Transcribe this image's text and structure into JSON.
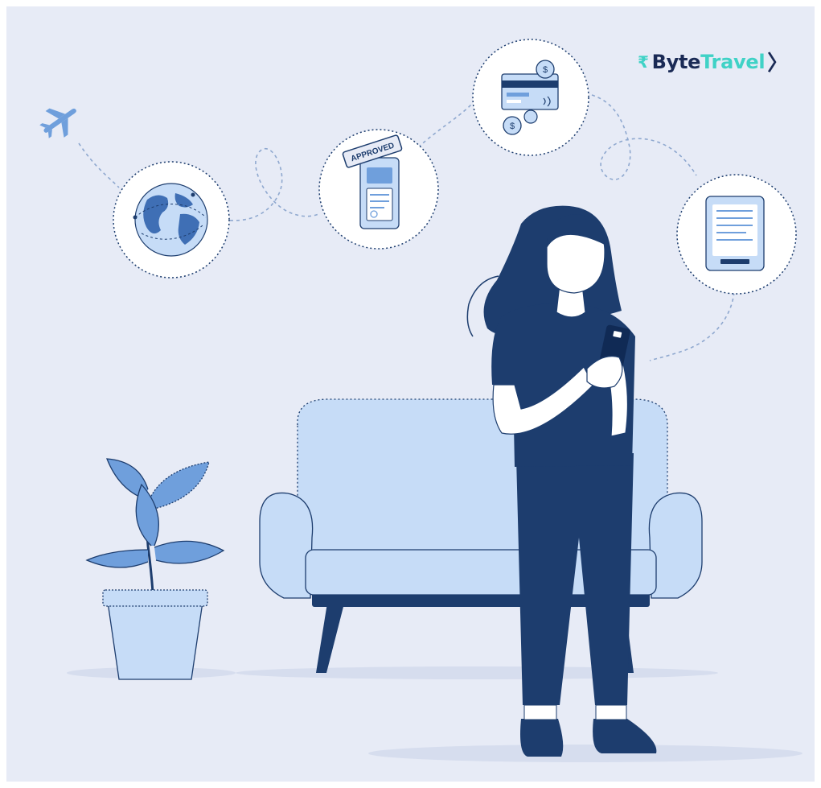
{
  "logo": {
    "currency_symbol": "₹",
    "word_primary": "Byte",
    "word_secondary": "Travel",
    "chevron": "〉"
  },
  "bubbles": {
    "approved_stamp": "APPROVED",
    "coin_symbol": "$"
  },
  "colors": {
    "background": "#e7ebf6",
    "navy": "#1d3d6e",
    "light_blue": "#c6dcf7",
    "mid_blue": "#6f9fdc",
    "accent_teal": "#3fd2c6"
  },
  "icons": [
    "airplane-icon",
    "globe-icon",
    "approved-visa-icon",
    "payment-card-icon",
    "tablet-form-icon",
    "phone-icon"
  ]
}
